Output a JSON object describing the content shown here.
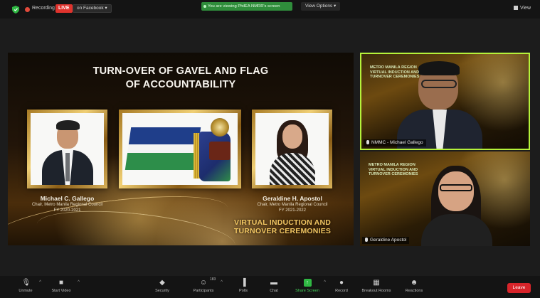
{
  "top_bar": {
    "recording_label": "Recording",
    "live_badge": "LIVE",
    "live_target": "on Facebook ▾",
    "viewing_banner": "You are viewing PhilEA NMRR's screen",
    "view_options": "View Options ▾",
    "view_label": "View"
  },
  "shared_screen": {
    "title_line1": "TURN-OVER OF GAVEL AND FLAG",
    "title_line2": "OF ACCOUNTABILITY",
    "left": {
      "name": "Michael C. Gallego",
      "role": "Chair, Metro Manila Regional Council",
      "term": "FY 2020-2021"
    },
    "right": {
      "name": "Geraldine H. Apostol",
      "role": "Chair, Metro Manila Regional Council",
      "term": "FY 2021-2022"
    },
    "event_line1": "VIRTUAL INDUCTION AND",
    "event_line2": "TURNOVER CEREMONIES"
  },
  "video_tiles": [
    {
      "name": "NMMC - Michael Gallego",
      "bg_text": "METRO MANILA REGION\nVIRTUAL INDUCTION AND\nTURNOVER CEREMONIES"
    },
    {
      "name": "Geraldine Apostol",
      "bg_text": "METRO MANILA REGION\nVIRTUAL INDUCTION AND\nTURNOVER CEREMONIES"
    }
  ],
  "toolbar": {
    "unmute": "Unmute",
    "start_video": "Start Video",
    "security": "Security",
    "participants": "Participants",
    "participants_count": "183",
    "polls": "Polls",
    "chat": "Chat",
    "share_screen": "Share Screen",
    "record": "Record",
    "breakout_rooms": "Breakout Rooms",
    "reactions": "Reactions",
    "leave": "Leave"
  },
  "colors": {
    "active_speaker_border": "#b5f23a",
    "live_red": "#e0332d",
    "leave_red": "#d8242a",
    "share_green": "#2fb843",
    "event_gold": "#f2c662"
  }
}
